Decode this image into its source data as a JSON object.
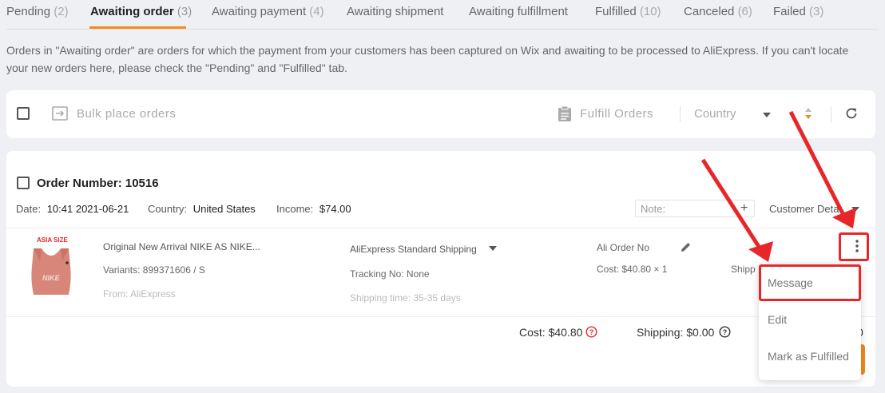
{
  "tabs": [
    {
      "label": "Pending",
      "count": "(2)"
    },
    {
      "label": "Awaiting order",
      "count": "(3)"
    },
    {
      "label": "Awaiting payment",
      "count": "(4)"
    },
    {
      "label": "Awaiting shipment",
      "count": ""
    },
    {
      "label": "Awaiting fulfillment",
      "count": ""
    },
    {
      "label": "Fulfilled",
      "count": "(10)"
    },
    {
      "label": "Canceled",
      "count": "(6)"
    },
    {
      "label": "Failed",
      "count": "(3)"
    }
  ],
  "info_text": "Orders in \"Awaiting order\" are orders for which the payment from your customers has been captured on Wix and awaiting to be processed to AliExpress. If you can't locate your new orders here, please check the \"Pending\" and \"Fulfilled\" tab.",
  "toolbar": {
    "bulk_label": "Bulk place orders",
    "fulfill_label": "Fulfill Orders",
    "country_placeholder": "Country"
  },
  "order": {
    "number_label": "Order Number: 10516",
    "date_label": "Date:",
    "date_value": "10:41 2021-06-21",
    "country_label": "Country:",
    "country_value": "United States",
    "income_label": "Income:",
    "income_value": "$74.00",
    "note_placeholder": "Note:",
    "customer_details": "Customer Details",
    "product": {
      "image_badge": "ASIA SIZE",
      "image_logo": "NIKE",
      "title": "Original New Arrival NIKE AS NIKE...",
      "variants": "Variants: 899371606 / S",
      "from": "From: AliExpress"
    },
    "shipping_method": "AliExpress Standard Shipping",
    "tracking": "Tracking No: None",
    "shipping_time": "Shipping time: 35-35 days",
    "ali_order_label": "Ali Order No",
    "cost_line": "Cost: $40.80 × 1",
    "shipping_cut": "Shipp",
    "cost_total": "Cost: $40.80",
    "shipping_total": "Shipping: $0.00",
    "total_cut": "0"
  },
  "menu": {
    "items": [
      "Message",
      "Edit",
      "Mark as Fulfilled"
    ]
  },
  "colors": {
    "accent": "#f48a1c",
    "annotation": "#e8262a"
  }
}
